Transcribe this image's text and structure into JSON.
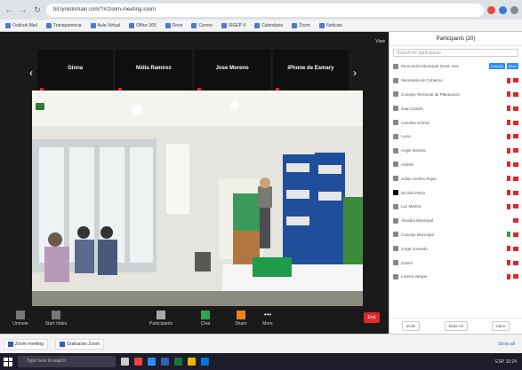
{
  "browser": {
    "address": "bit.lynkdomain.com/?#/zoom-meeting-room",
    "bookmarks": [
      "Outlook Mail",
      "Transparencia",
      "Aula Virtual",
      "Office 365",
      "Drive",
      "Correo",
      "SIGEP II",
      "Calendario",
      "Zoom",
      "Noticias"
    ]
  },
  "zoom": {
    "view_label": "View",
    "strip": [
      {
        "name": "Ginna"
      },
      {
        "name": "Nidia Ramirez"
      },
      {
        "name": "Jose Moreno"
      },
      {
        "name": "iPhone de Esmary"
      }
    ],
    "toolbar": [
      {
        "label": "Unmute"
      },
      {
        "label": "Start Video"
      },
      {
        "label": "Participants"
      },
      {
        "label": "Chat"
      },
      {
        "label": "Share"
      },
      {
        "label": "More"
      }
    ],
    "end": "End"
  },
  "participants": {
    "title": "Participants (20)",
    "search_placeholder": "Search for participants",
    "host_actions": [
      "Unmute",
      "More"
    ],
    "items": [
      "Personería Municipal (Host, me)",
      "Secretaría de Gobierno",
      "Consejo Territorial de Planeación",
      "Juan Camilo",
      "Carolina Gómez",
      "Lucia",
      "Angie Moreno",
      "Andrés",
      "Julian Andrés Rojas",
      "Nicolás Parra",
      "Luz Marina",
      "Alcaldía Municipal",
      "Concejo Municipal",
      "Jorge Acevedo",
      "Daniel",
      "Lorena Vargas"
    ],
    "footer": [
      "Invite",
      "Mute All",
      "More"
    ]
  },
  "tabs": {
    "items": [
      "Zoom meeting",
      "Grabación Zoom"
    ],
    "show_all": "Show all"
  },
  "taskbar": {
    "search_placeholder": "Type here to search",
    "tray": "ESP 10:24"
  }
}
